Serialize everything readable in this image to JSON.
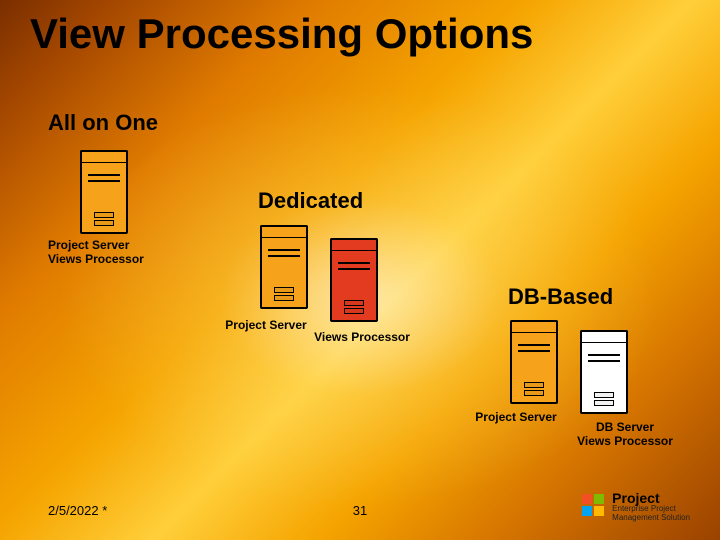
{
  "title": "View Processing Options",
  "sections": {
    "all_on_one": {
      "label": "All on One",
      "server1_caption": "Project Server\nViews Processor"
    },
    "dedicated": {
      "label": "Dedicated",
      "server1_caption": "Project Server",
      "server2_caption": "Views Processor"
    },
    "db_based": {
      "label": "DB-Based",
      "server1_caption": "Project Server",
      "server2_caption": "DB Server\nViews Processor"
    }
  },
  "footer": {
    "date": "2/5/2022 *",
    "page": "31"
  },
  "logo": {
    "product": "Project",
    "subtitle": "Enterprise Project\nManagement Solution"
  }
}
